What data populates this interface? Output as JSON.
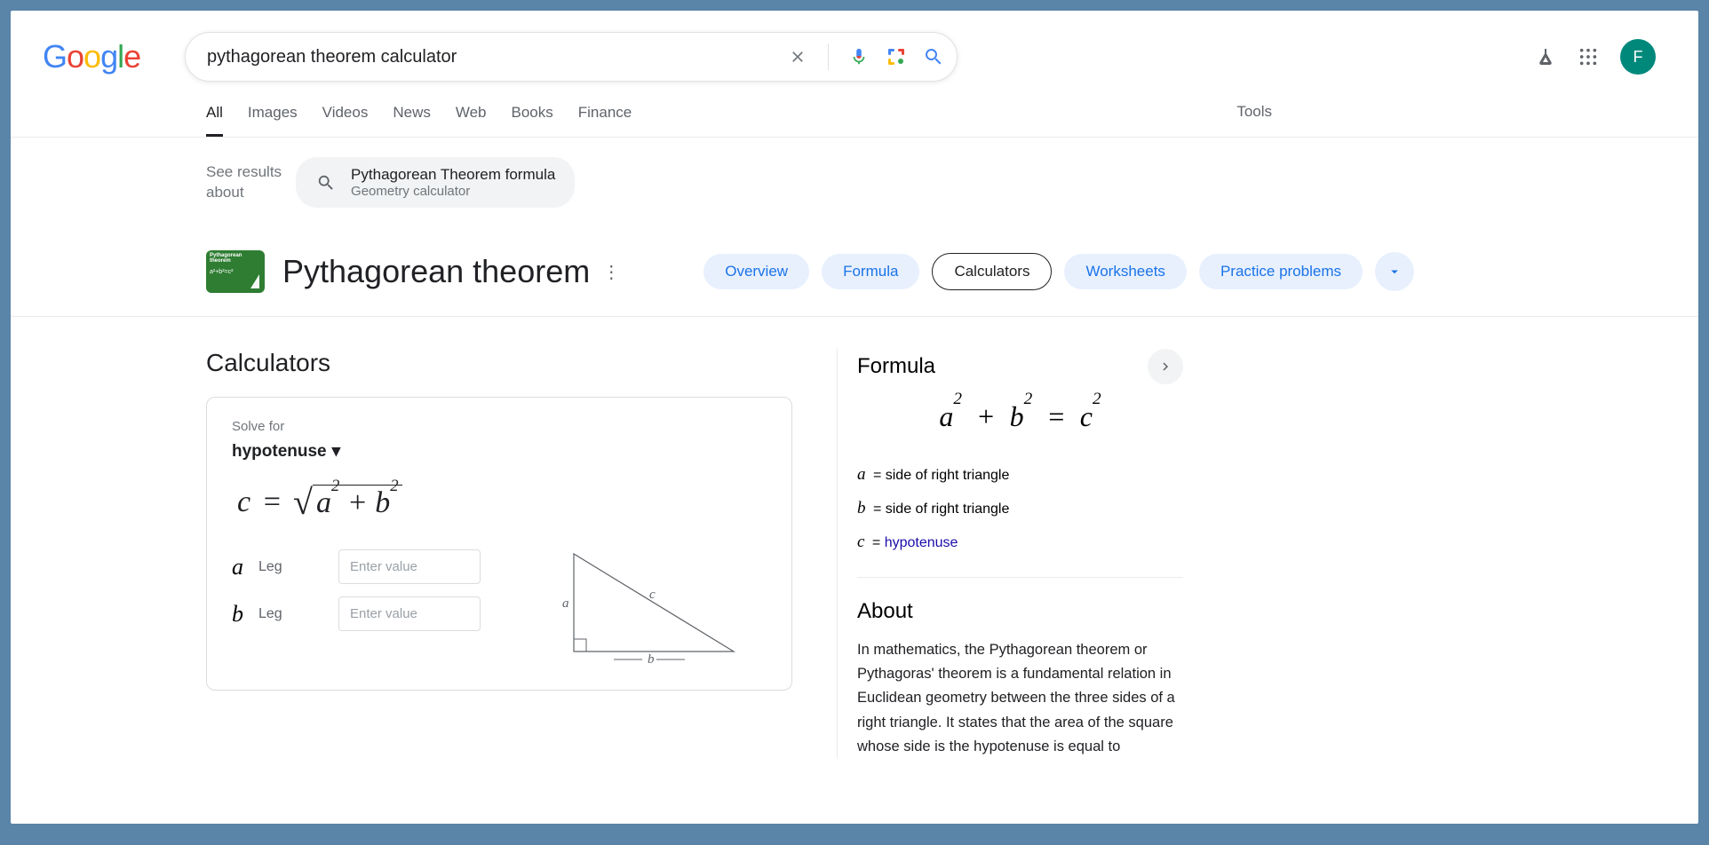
{
  "header": {
    "search_query": "pythagorean theorem calculator",
    "avatar_letter": "F"
  },
  "nav": {
    "tabs": [
      "All",
      "Images",
      "Videos",
      "News",
      "Web",
      "Books",
      "Finance"
    ],
    "tools": "Tools"
  },
  "see_about": {
    "label": "See results about",
    "chip_title": "Pythagorean Theorem formula",
    "chip_subtitle": "Geometry calculator"
  },
  "topic": {
    "thumb_text": "Pythagorean theorem",
    "thumb_formula": "a²+b²=c²",
    "title": "Pythagorean theorem",
    "chips": [
      "Overview",
      "Formula",
      "Calculators",
      "Worksheets",
      "Practice problems"
    ],
    "active_chip": "Calculators"
  },
  "calculator": {
    "heading": "Calculators",
    "solve_label": "Solve for",
    "solve_value": "hypotenuse",
    "formula": {
      "lhs": "c",
      "eq": "=",
      "inside_a": "a",
      "inside_b": "b"
    },
    "rows": [
      {
        "var": "a",
        "label": "Leg",
        "placeholder": "Enter value"
      },
      {
        "var": "b",
        "label": "Leg",
        "placeholder": "Enter value"
      }
    ],
    "diagram_labels": {
      "a": "a",
      "b": "b",
      "c": "c"
    }
  },
  "formula_panel": {
    "heading": "Formula",
    "expr": {
      "a": "a",
      "b": "b",
      "c": "c",
      "plus": "+",
      "eq": "="
    },
    "legend": [
      {
        "var": "a",
        "text": "= side of right triangle",
        "link": false
      },
      {
        "var": "b",
        "text": "= side of right triangle",
        "link": false
      },
      {
        "var": "c",
        "text": "= ",
        "link_text": "hypotenuse",
        "link": true
      }
    ]
  },
  "about": {
    "heading": "About",
    "text": "In mathematics, the Pythagorean theorem or Pythagoras' theorem is a fundamental relation in Euclidean geometry between the three sides of a right triangle. It states that the area of the square whose side is the hypotenuse is equal to"
  }
}
